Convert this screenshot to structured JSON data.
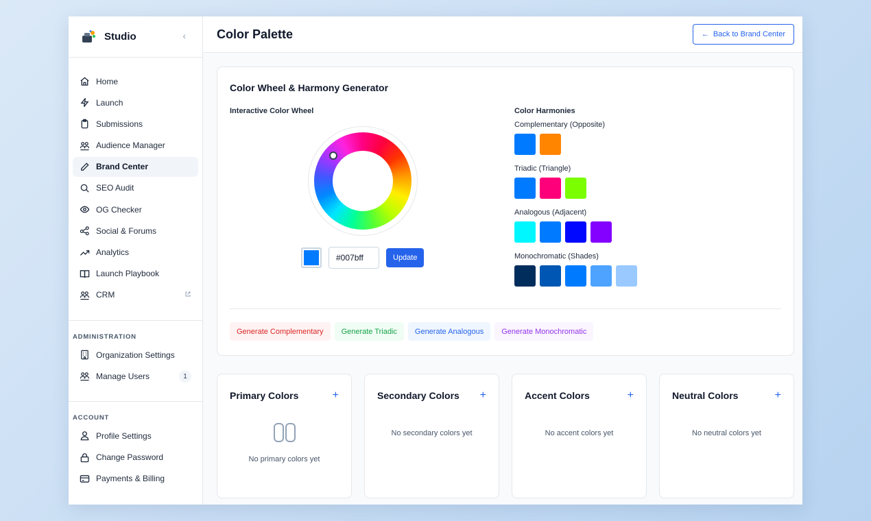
{
  "app": {
    "name": "Studio"
  },
  "sidebar": {
    "items": [
      {
        "label": "Home",
        "icon": "home-icon"
      },
      {
        "label": "Launch",
        "icon": "lightning-icon"
      },
      {
        "label": "Submissions",
        "icon": "clipboard-icon"
      },
      {
        "label": "Audience Manager",
        "icon": "users-icon"
      },
      {
        "label": "Brand Center",
        "icon": "pen-icon",
        "active": true
      },
      {
        "label": "SEO Audit",
        "icon": "search-icon"
      },
      {
        "label": "OG Checker",
        "icon": "eye-icon"
      },
      {
        "label": "Social & Forums",
        "icon": "share-icon"
      },
      {
        "label": "Analytics",
        "icon": "trend-icon"
      },
      {
        "label": "Launch Playbook",
        "icon": "book-icon"
      },
      {
        "label": "CRM",
        "icon": "users-icon",
        "external": true
      }
    ],
    "administration": {
      "title": "ADMINISTRATION",
      "items": [
        {
          "label": "Organization Settings",
          "icon": "building-icon"
        },
        {
          "label": "Manage Users",
          "icon": "users-icon",
          "badge": "1"
        }
      ]
    },
    "account": {
      "title": "ACCOUNT",
      "items": [
        {
          "label": "Profile Settings",
          "icon": "user-icon"
        },
        {
          "label": "Change Password",
          "icon": "lock-icon"
        },
        {
          "label": "Payments & Billing",
          "icon": "card-icon"
        }
      ]
    }
  },
  "header": {
    "title": "Color Palette",
    "back_label": "Back to Brand Center"
  },
  "wheel_card": {
    "title": "Color Wheel & Harmony Generator",
    "wheel_label": "Interactive Color Wheel",
    "hex_value": "#007bff",
    "update_label": "Update",
    "harmonies_label": "Color Harmonies",
    "harmonies": [
      {
        "label": "Complementary (Opposite)",
        "colors": [
          "#007bff",
          "#ff8400"
        ]
      },
      {
        "label": "Triadic (Triangle)",
        "colors": [
          "#007bff",
          "#ff007b",
          "#7bff00"
        ]
      },
      {
        "label": "Analogous (Adjacent)",
        "colors": [
          "#00f7ff",
          "#007bff",
          "#0008ff",
          "#8400ff"
        ]
      },
      {
        "label": "Monochromatic (Shades)",
        "colors": [
          "#002d5c",
          "#0057b3",
          "#007bff",
          "#4da3ff",
          "#99c9ff"
        ]
      }
    ],
    "generate_buttons": {
      "complementary": "Generate Complementary",
      "triadic": "Generate Triadic",
      "analogous": "Generate Analogous",
      "monochromatic": "Generate Monochromatic"
    }
  },
  "groups": [
    {
      "title": "Primary Colors",
      "empty": "No primary colors yet"
    },
    {
      "title": "Secondary Colors",
      "empty": "No secondary colors yet"
    },
    {
      "title": "Accent Colors",
      "empty": "No accent colors yet"
    },
    {
      "title": "Neutral Colors",
      "empty": "No neutral colors yet"
    }
  ],
  "colors": {
    "accent": "#2563eb",
    "selected": "#007bff"
  }
}
